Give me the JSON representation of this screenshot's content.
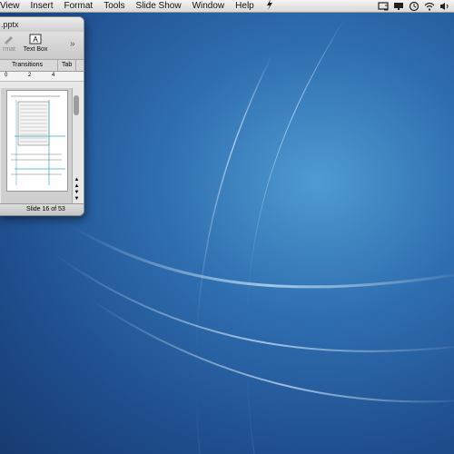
{
  "menubar": {
    "items": [
      "View",
      "Insert",
      "Format",
      "Tools",
      "Slide Show",
      "Window",
      "Help"
    ],
    "script_icon": "script-menu-icon",
    "status_icons": [
      "display-icon",
      "monitor-icon",
      "time-machine-icon",
      "wifi-icon",
      "volume-icon"
    ]
  },
  "window": {
    "title": ".pptx",
    "toolbar": {
      "format_label": "rmat",
      "textbox_label": "Text Box",
      "more": "»"
    },
    "tabs": [
      "Transitions",
      "Tab"
    ],
    "ruler_marks": [
      "0",
      "2",
      "4"
    ],
    "status": {
      "slide_text": "Slide 16 of 53"
    }
  }
}
